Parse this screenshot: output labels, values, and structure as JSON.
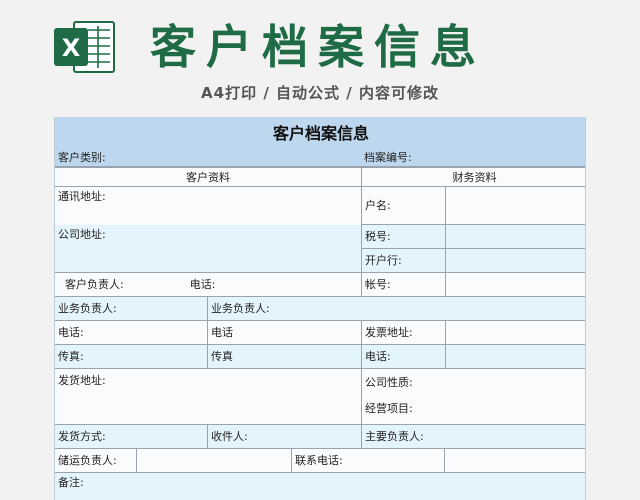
{
  "header": {
    "title": "客户档案信息",
    "subtitle": "A4打印 / 自动公式 / 内容可修改",
    "logo_letter": "X"
  },
  "colors": {
    "brand_green": "#1e6b45",
    "header_blue": "#bdd7ee",
    "row_blue": "#e3f4fc"
  },
  "form": {
    "title": "客户档案信息",
    "customer_type": "客户类别:",
    "file_no": "档案编号:",
    "section_customer": "客户资料",
    "section_finance": "财务资料",
    "mail_address": "通讯地址:",
    "account_name": "户名:",
    "company_address": "公司地址:",
    "tax_no": "税号:",
    "bank": "开户行:",
    "customer_manager": "客户负责人:",
    "phone_colon": "电话:",
    "account_no": "帐号:",
    "biz_manager_1": "业务负责人:",
    "biz_manager_2": "业务负责人:",
    "phone_a": "电话:",
    "phone_b": "电话",
    "invoice_address": "发票地址:",
    "fax_a": "传真:",
    "fax_b": "传真",
    "phone_c": "电话:",
    "ship_address": "发货地址:",
    "company_nature": "公司性质:",
    "business_scope": "经营项目:",
    "ship_method": "发货方式:",
    "receiver": "收件人:",
    "main_manager": "主要负责人:",
    "storage_manager": "储运负责人:",
    "contact": "联系电话:",
    "remarks": "备注:"
  }
}
